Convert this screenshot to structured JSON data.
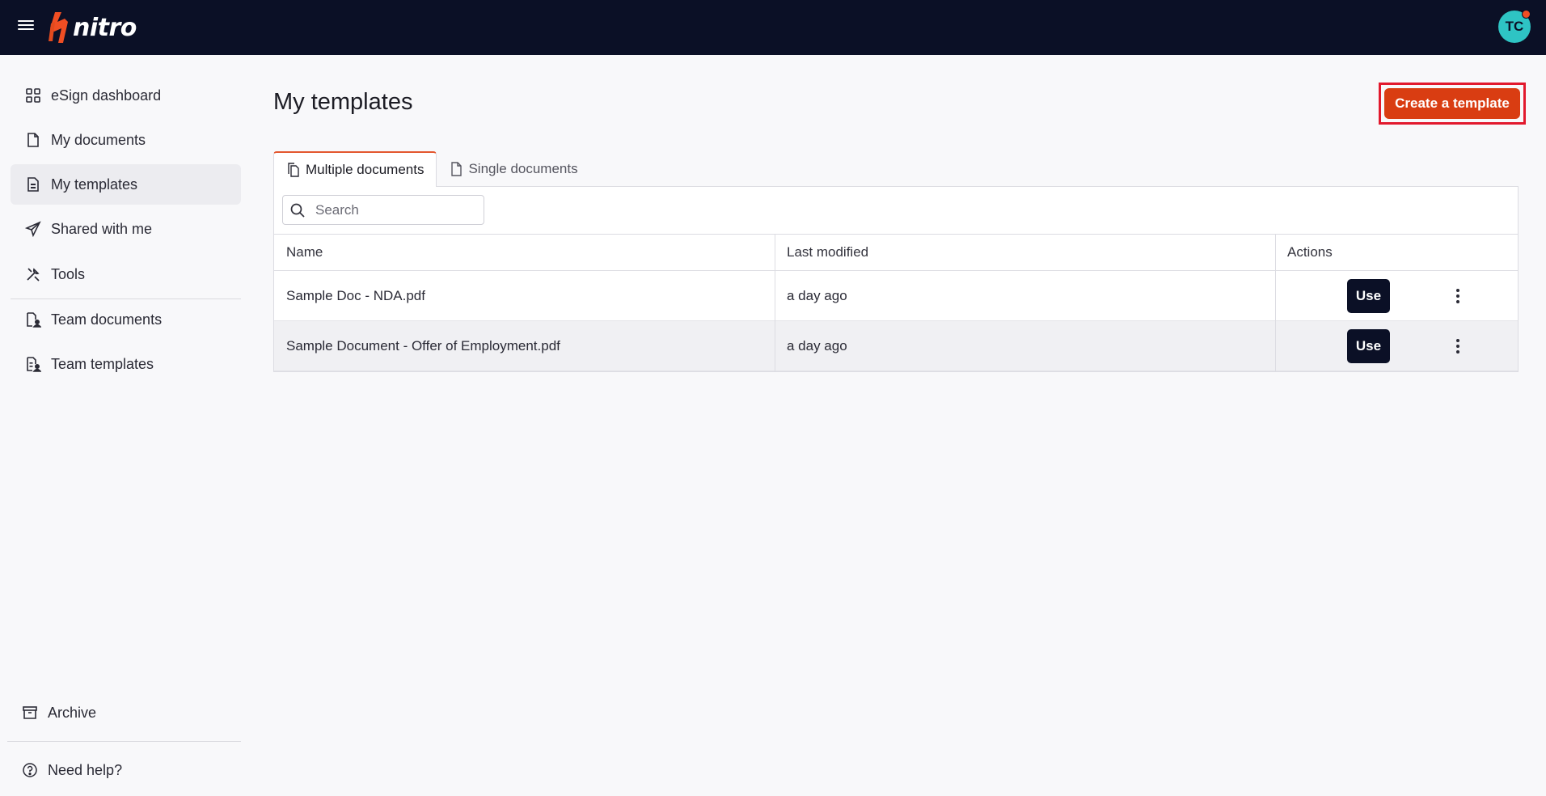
{
  "topbar": {
    "menu_icon": "hamburger-icon",
    "logo_text": "nitro",
    "avatar_initials": "TC",
    "accent_color": "#f04e23",
    "background": "#0b1026"
  },
  "sidebar": {
    "items": [
      {
        "label": "eSign dashboard",
        "icon": "grid-icon"
      },
      {
        "label": "My documents",
        "icon": "document-icon"
      },
      {
        "label": "My templates",
        "icon": "template-icon",
        "active": true
      },
      {
        "label": "Shared with me",
        "icon": "paper-plane-icon"
      },
      {
        "label": "Tools",
        "icon": "tools-icon"
      },
      {
        "label": "Team documents",
        "icon": "team-document-icon"
      },
      {
        "label": "Team templates",
        "icon": "team-template-icon"
      }
    ],
    "archive_label": "Archive",
    "help_label": "Need help?"
  },
  "main": {
    "title": "My templates",
    "create_button": "Create a template",
    "create_button_color": "#d93d12",
    "tabs": [
      {
        "label": "Multiple documents",
        "icon": "documents-icon",
        "active": true
      },
      {
        "label": "Single documents",
        "icon": "document-icon",
        "active": false
      }
    ],
    "search": {
      "placeholder": "Search",
      "value": ""
    },
    "table": {
      "columns": [
        "Name",
        "Last modified",
        "Actions"
      ],
      "rows": [
        {
          "name": "Sample Doc - NDA.pdf",
          "modified": "a day ago",
          "action": "Use"
        },
        {
          "name": "Sample Document - Offer of Employment.pdf",
          "modified": "a day ago",
          "action": "Use"
        }
      ]
    }
  }
}
